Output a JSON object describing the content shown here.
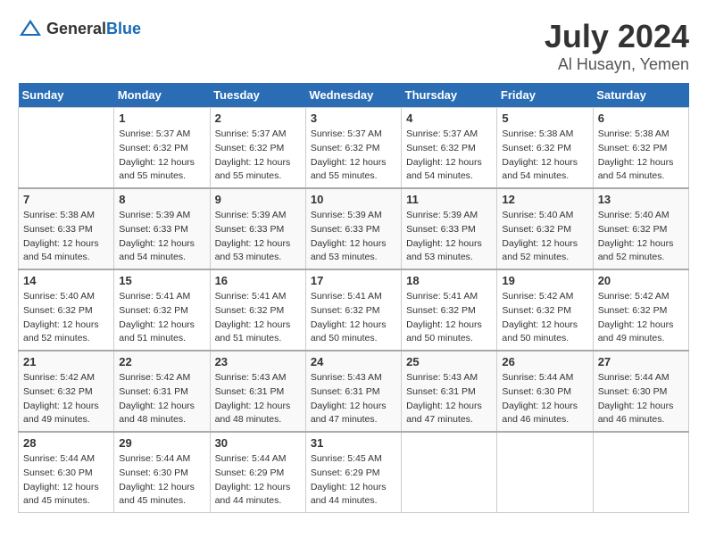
{
  "header": {
    "logo_general": "General",
    "logo_blue": "Blue",
    "title": "July 2024",
    "subtitle": "Al Husayn, Yemen"
  },
  "calendar": {
    "days_of_week": [
      "Sunday",
      "Monday",
      "Tuesday",
      "Wednesday",
      "Thursday",
      "Friday",
      "Saturday"
    ],
    "weeks": [
      [
        {
          "day": "",
          "info": ""
        },
        {
          "day": "1",
          "info": "Sunrise: 5:37 AM\nSunset: 6:32 PM\nDaylight: 12 hours\nand 55 minutes."
        },
        {
          "day": "2",
          "info": "Sunrise: 5:37 AM\nSunset: 6:32 PM\nDaylight: 12 hours\nand 55 minutes."
        },
        {
          "day": "3",
          "info": "Sunrise: 5:37 AM\nSunset: 6:32 PM\nDaylight: 12 hours\nand 55 minutes."
        },
        {
          "day": "4",
          "info": "Sunrise: 5:37 AM\nSunset: 6:32 PM\nDaylight: 12 hours\nand 54 minutes."
        },
        {
          "day": "5",
          "info": "Sunrise: 5:38 AM\nSunset: 6:32 PM\nDaylight: 12 hours\nand 54 minutes."
        },
        {
          "day": "6",
          "info": "Sunrise: 5:38 AM\nSunset: 6:32 PM\nDaylight: 12 hours\nand 54 minutes."
        }
      ],
      [
        {
          "day": "7",
          "info": "Sunrise: 5:38 AM\nSunset: 6:33 PM\nDaylight: 12 hours\nand 54 minutes."
        },
        {
          "day": "8",
          "info": "Sunrise: 5:39 AM\nSunset: 6:33 PM\nDaylight: 12 hours\nand 54 minutes."
        },
        {
          "day": "9",
          "info": "Sunrise: 5:39 AM\nSunset: 6:33 PM\nDaylight: 12 hours\nand 53 minutes."
        },
        {
          "day": "10",
          "info": "Sunrise: 5:39 AM\nSunset: 6:33 PM\nDaylight: 12 hours\nand 53 minutes."
        },
        {
          "day": "11",
          "info": "Sunrise: 5:39 AM\nSunset: 6:33 PM\nDaylight: 12 hours\nand 53 minutes."
        },
        {
          "day": "12",
          "info": "Sunrise: 5:40 AM\nSunset: 6:32 PM\nDaylight: 12 hours\nand 52 minutes."
        },
        {
          "day": "13",
          "info": "Sunrise: 5:40 AM\nSunset: 6:32 PM\nDaylight: 12 hours\nand 52 minutes."
        }
      ],
      [
        {
          "day": "14",
          "info": "Sunrise: 5:40 AM\nSunset: 6:32 PM\nDaylight: 12 hours\nand 52 minutes."
        },
        {
          "day": "15",
          "info": "Sunrise: 5:41 AM\nSunset: 6:32 PM\nDaylight: 12 hours\nand 51 minutes."
        },
        {
          "day": "16",
          "info": "Sunrise: 5:41 AM\nSunset: 6:32 PM\nDaylight: 12 hours\nand 51 minutes."
        },
        {
          "day": "17",
          "info": "Sunrise: 5:41 AM\nSunset: 6:32 PM\nDaylight: 12 hours\nand 50 minutes."
        },
        {
          "day": "18",
          "info": "Sunrise: 5:41 AM\nSunset: 6:32 PM\nDaylight: 12 hours\nand 50 minutes."
        },
        {
          "day": "19",
          "info": "Sunrise: 5:42 AM\nSunset: 6:32 PM\nDaylight: 12 hours\nand 50 minutes."
        },
        {
          "day": "20",
          "info": "Sunrise: 5:42 AM\nSunset: 6:32 PM\nDaylight: 12 hours\nand 49 minutes."
        }
      ],
      [
        {
          "day": "21",
          "info": "Sunrise: 5:42 AM\nSunset: 6:32 PM\nDaylight: 12 hours\nand 49 minutes."
        },
        {
          "day": "22",
          "info": "Sunrise: 5:42 AM\nSunset: 6:31 PM\nDaylight: 12 hours\nand 48 minutes."
        },
        {
          "day": "23",
          "info": "Sunrise: 5:43 AM\nSunset: 6:31 PM\nDaylight: 12 hours\nand 48 minutes."
        },
        {
          "day": "24",
          "info": "Sunrise: 5:43 AM\nSunset: 6:31 PM\nDaylight: 12 hours\nand 47 minutes."
        },
        {
          "day": "25",
          "info": "Sunrise: 5:43 AM\nSunset: 6:31 PM\nDaylight: 12 hours\nand 47 minutes."
        },
        {
          "day": "26",
          "info": "Sunrise: 5:44 AM\nSunset: 6:30 PM\nDaylight: 12 hours\nand 46 minutes."
        },
        {
          "day": "27",
          "info": "Sunrise: 5:44 AM\nSunset: 6:30 PM\nDaylight: 12 hours\nand 46 minutes."
        }
      ],
      [
        {
          "day": "28",
          "info": "Sunrise: 5:44 AM\nSunset: 6:30 PM\nDaylight: 12 hours\nand 45 minutes."
        },
        {
          "day": "29",
          "info": "Sunrise: 5:44 AM\nSunset: 6:30 PM\nDaylight: 12 hours\nand 45 minutes."
        },
        {
          "day": "30",
          "info": "Sunrise: 5:44 AM\nSunset: 6:29 PM\nDaylight: 12 hours\nand 44 minutes."
        },
        {
          "day": "31",
          "info": "Sunrise: 5:45 AM\nSunset: 6:29 PM\nDaylight: 12 hours\nand 44 minutes."
        },
        {
          "day": "",
          "info": ""
        },
        {
          "day": "",
          "info": ""
        },
        {
          "day": "",
          "info": ""
        }
      ]
    ]
  }
}
